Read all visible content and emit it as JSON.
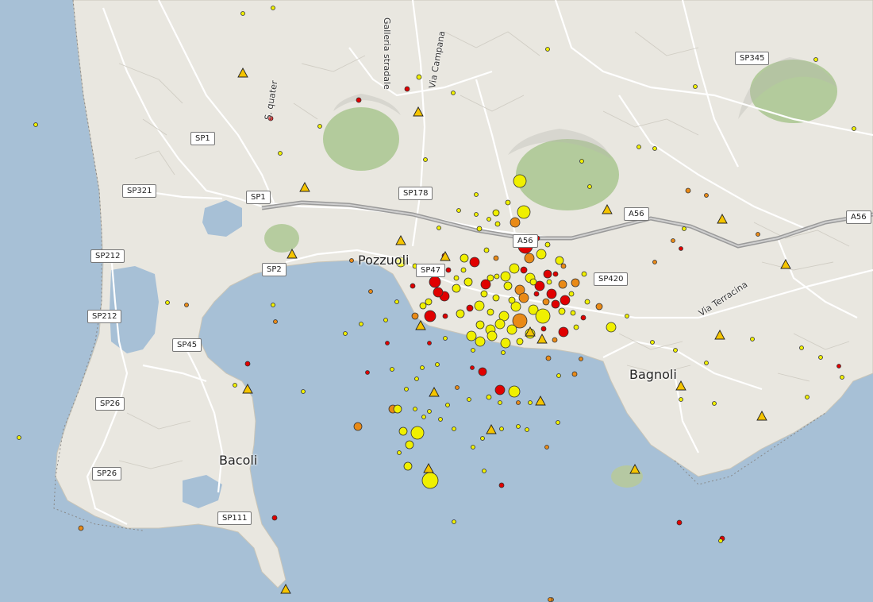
{
  "map": {
    "places": {
      "pozzuoli": "Pozzuoli",
      "bagnoli": "Bagnoli",
      "bacoli": "Bacoli"
    },
    "streets": {
      "galleria": "Galleria stradale",
      "campana": "Via Campana",
      "terracina": "Via Terracina",
      "quater": "S. quater"
    },
    "roads": {
      "sp1_a": "SP1",
      "sp1_b": "SP1",
      "sp321": "SP321",
      "sp212_a": "SP212",
      "sp212_b": "SP212",
      "sp2": "SP2",
      "sp45": "SP45",
      "sp26_a": "SP26",
      "sp26_b": "SP26",
      "sp111": "SP111",
      "sp47": "SP47",
      "sp178": "SP178",
      "a56_a": "A56",
      "a56_b": "A56",
      "a56_c": "A56",
      "sp420": "SP420",
      "sp345": "SP345"
    },
    "colors": {
      "sea": "#a7c0d6",
      "land": "#e8e6df",
      "crater": "#9fbf8a",
      "road": "#ffffff",
      "motorway": "#8e8e8e",
      "event_red": "#e00000",
      "event_orange": "#e98a17",
      "event_yellow": "#f0f000",
      "station": "#f5c400"
    },
    "legend_icons": {
      "event": "earthquake-event-circle",
      "station": "seismic-station-triangle"
    }
  }
}
